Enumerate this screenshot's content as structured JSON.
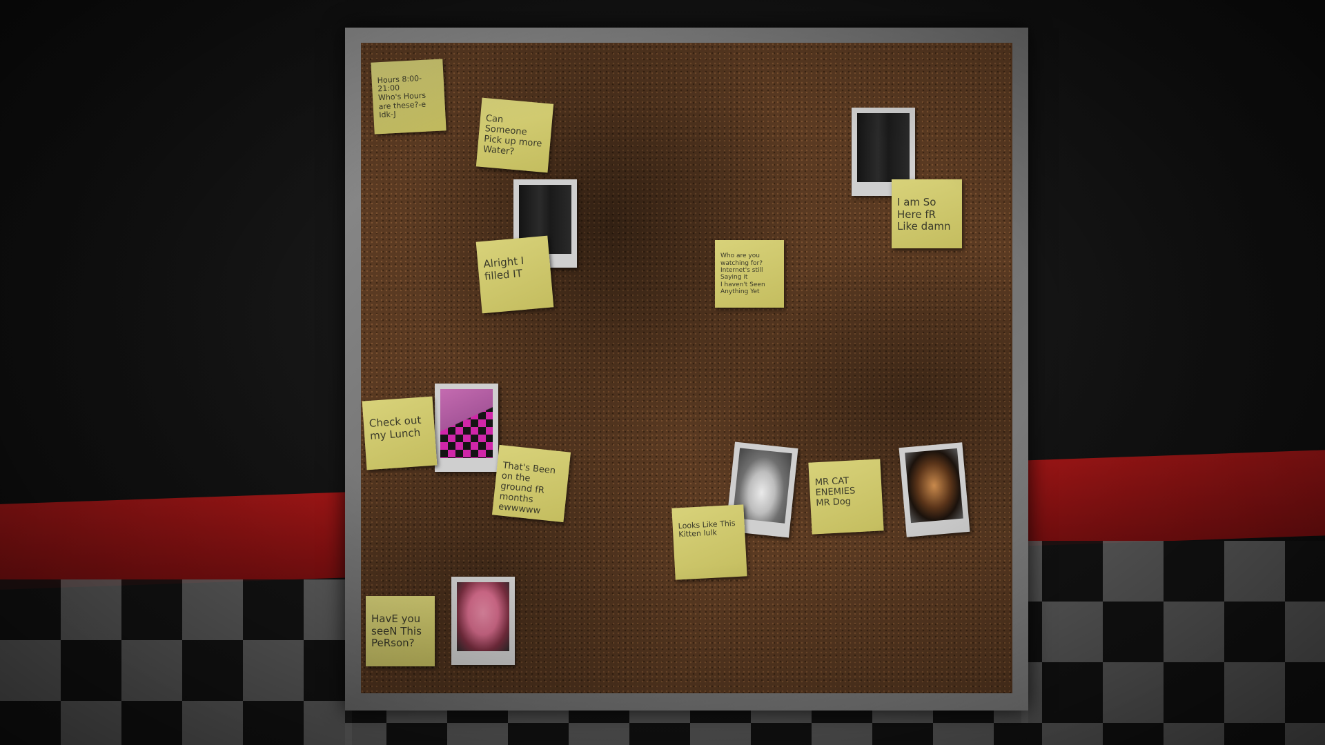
{
  "notes": {
    "hours": "Hours 8:00-21:00\nWho's Hours are these?-e\nIdk-J",
    "water": "Can Someone Pick up more Water?",
    "alright": "Alright I filled IT",
    "watching": "Who are you watching for?\nInternet's still Saying it\nI haven't Seen Anything Yet",
    "here": "I am So Here fR Like damn",
    "lunch": "Check out my Lunch",
    "ground": "That's Been on the ground fR months ewwwww",
    "cat": "Looks Like This\nKitten lulk",
    "enemies": "MR CAT\nENEMIES\nMR Dog",
    "person": "HavE you seeN This PeRson?"
  },
  "photos": {
    "door_left": "door",
    "door_right": "door",
    "room": "pink-checkered-room",
    "cat": "cat",
    "dog": "puppy",
    "person": "pink-hedgehog"
  },
  "colors": {
    "note": "#d8d27a",
    "cork": "#5a3a22",
    "frame": "#8a8a8a",
    "stripe": "#a01616"
  }
}
